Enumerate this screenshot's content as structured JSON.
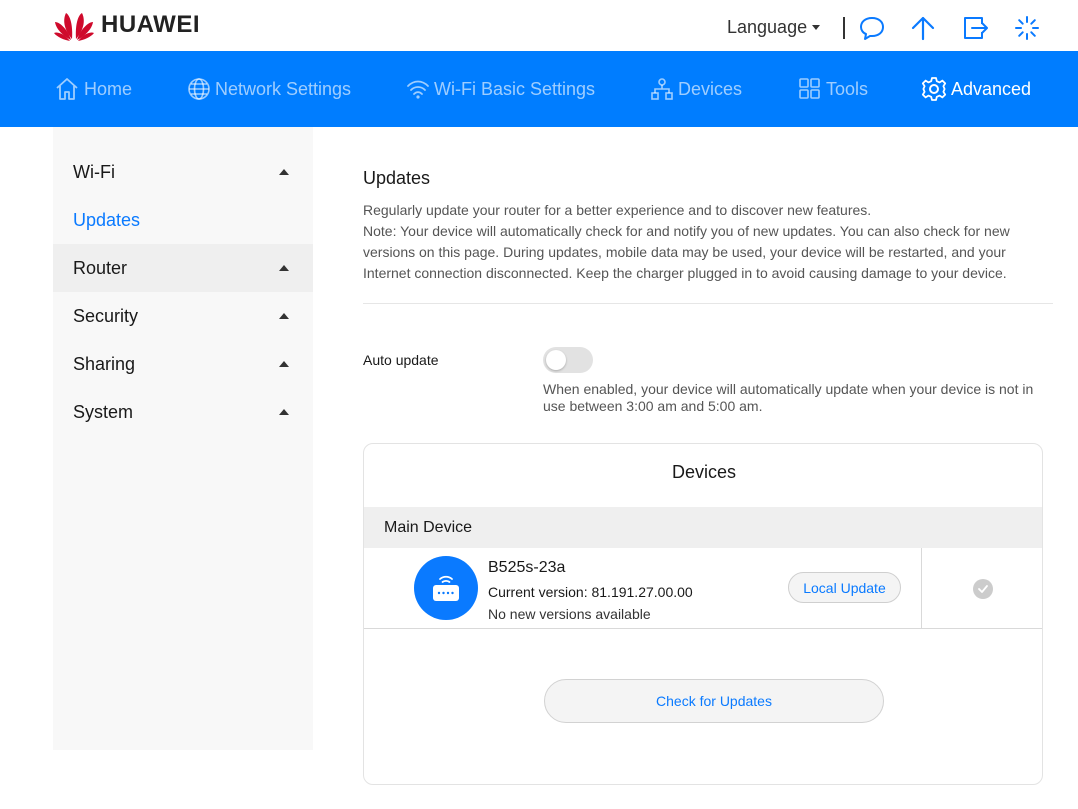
{
  "brand": {
    "name": "HUAWEI"
  },
  "topbar": {
    "language_label": "Language",
    "icons": [
      "chat-icon",
      "upload-arrow-icon",
      "logout-icon",
      "loading-icon"
    ]
  },
  "nav": {
    "home": "Home",
    "network_settings": "Network Settings",
    "wifi_basic_settings": "Wi-Fi Basic Settings",
    "devices": "Devices",
    "tools": "Tools",
    "advanced": "Advanced",
    "active": "Advanced"
  },
  "sidebar": {
    "items": [
      {
        "label": "Wi-Fi",
        "expanded": true
      },
      {
        "label": "Updates",
        "selected": true
      },
      {
        "label": "Router",
        "expanded": true
      },
      {
        "label": "Security",
        "expanded": true
      },
      {
        "label": "Sharing",
        "expanded": true
      },
      {
        "label": "System",
        "expanded": true
      }
    ]
  },
  "main": {
    "title": "Updates",
    "description": "Regularly update your router for a better experience and to discover new features.",
    "note": "Note: Your device will automatically check for and notify you of new updates. You can also check for new versions on this page. During updates, mobile data may be used, your device will be restarted, and your Internet connection disconnected. Keep the charger plugged in to avoid causing damage to your device.",
    "auto_update": {
      "label": "Auto update",
      "enabled": false,
      "description": "When enabled, your device will automatically update when your device is not in use between 3:00 am and 5:00 am."
    },
    "devices_card": {
      "title": "Devices",
      "section": "Main Device",
      "device": {
        "name": "B525s-23a",
        "current_version_label": "Current version: 81.191.27.00.00",
        "status": "No new versions available",
        "local_update_label": "Local Update"
      },
      "check_button_label": "Check for Updates"
    }
  },
  "colors": {
    "accent": "#007dff",
    "link": "#0a7aff",
    "sidebar_bg": "#f8f8f8",
    "brand_red": "#cf0a2c"
  }
}
